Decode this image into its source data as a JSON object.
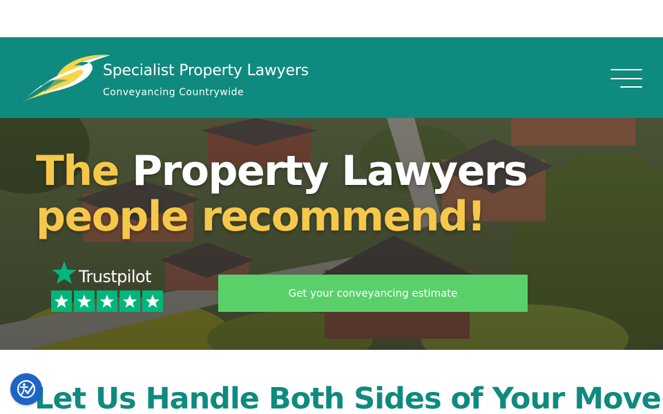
{
  "brand": {
    "name": "Specialist Property Lawyers",
    "tagline": "Conveyancing Countrywide",
    "logo_icon": "swoosh-logo-icon",
    "colors": {
      "header_bg": "#0f8a7e",
      "accent_yellow": "#f6c84a",
      "cta_green": "#5ad06b",
      "trustpilot_green": "#00b67a",
      "heading_teal": "#0f8a7e",
      "accessibility_blue": "#1d63c8"
    }
  },
  "header": {
    "menu_icon": "hamburger-menu-icon"
  },
  "hero": {
    "title_part1": "The",
    "title_part2": "Property Lawyers",
    "title_line2": "people recommend!",
    "background": "aerial-view-of-housing-estate",
    "trustpilot": {
      "wordmark": "Trustpilot",
      "rating_stars": 5
    },
    "cta_label": "Get your conveyancing estimate"
  },
  "section": {
    "heading": "Let Us Handle Both Sides of Your Move"
  },
  "accessibility": {
    "icon": "accessibility-icon"
  }
}
